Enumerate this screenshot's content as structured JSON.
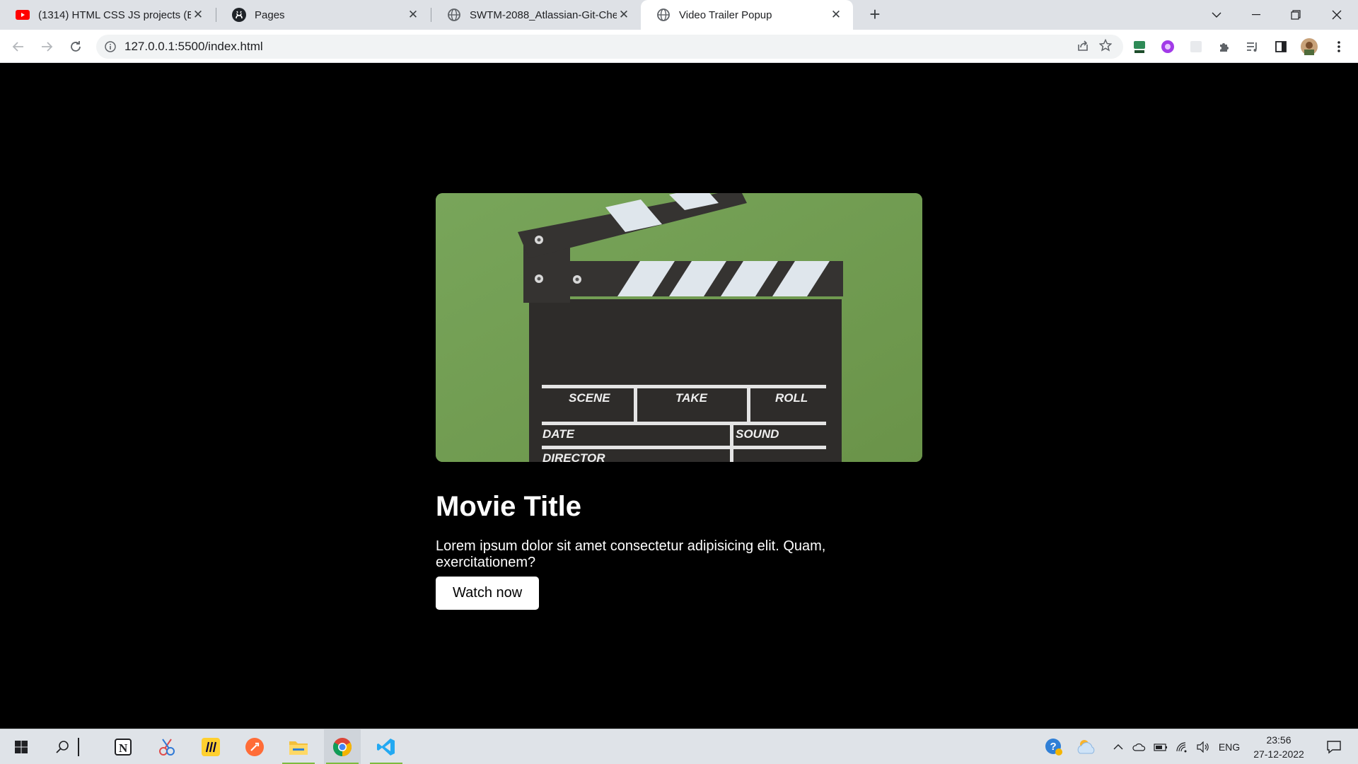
{
  "browser": {
    "tabs": [
      {
        "title": "(1314) HTML CSS JS projects (Beg",
        "icon": "youtube-icon",
        "active": false
      },
      {
        "title": "Pages",
        "icon": "github-icon",
        "active": false
      },
      {
        "title": "SWTM-2088_Atlassian-Git-Cheat",
        "icon": "globe-icon",
        "active": false
      },
      {
        "title": "Video Trailer Popup",
        "icon": "globe-icon",
        "active": true
      }
    ],
    "url": "127.0.0.1:5500/index.html"
  },
  "page": {
    "poster_labels": {
      "scene": "SCENE",
      "take": "TAKE",
      "roll": "ROLL",
      "date": "DATE",
      "sound": "SOUND",
      "director": "DIRECTOR"
    },
    "title": "Movie Title",
    "description": "Lorem ipsum dolor sit amet consectetur adipisicing elit. Quam, exercitationem?",
    "button_label": "Watch now"
  },
  "taskbar": {
    "language": "ENG",
    "time": "23:56",
    "date": "27-12-2022"
  },
  "colors": {
    "page_background": "#000000",
    "poster_background": "#6f9a50",
    "button_background": "#ffffff"
  }
}
